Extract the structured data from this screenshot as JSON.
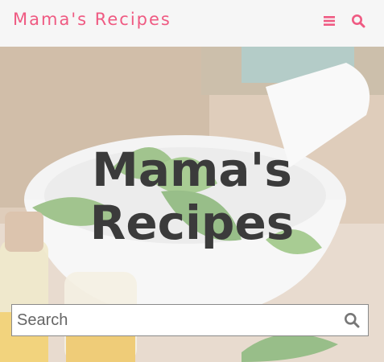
{
  "header": {
    "brand": "Mama's Recipes",
    "brand_color": "#ef5a82",
    "icons": [
      "menu-icon",
      "search-icon"
    ]
  },
  "hero": {
    "title_line1": "Mama's",
    "title_line2": "Recipes"
  },
  "search": {
    "placeholder": "Search",
    "icon": "search-icon",
    "value": ""
  }
}
